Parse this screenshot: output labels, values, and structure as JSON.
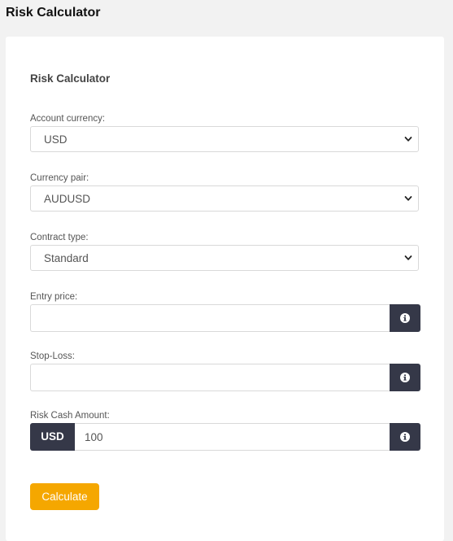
{
  "page": {
    "title": "Risk Calculator"
  },
  "card": {
    "title": "Risk Calculator"
  },
  "fields": {
    "account_currency": {
      "label": "Account currency:",
      "value": "USD"
    },
    "currency_pair": {
      "label": "Currency pair:",
      "value": "AUDUSD"
    },
    "contract_type": {
      "label": "Contract type:",
      "value": "Standard"
    },
    "entry_price": {
      "label": "Entry price:",
      "value": ""
    },
    "stop_loss": {
      "label": "Stop-Loss:",
      "value": ""
    },
    "risk_cash_amount": {
      "label": "Risk Cash Amount:",
      "currency": "USD",
      "value": "100"
    }
  },
  "actions": {
    "calculate_label": "Calculate"
  },
  "icons": {
    "chevron": "chevron-down-icon",
    "info": "info-icon"
  },
  "colors": {
    "accent": "#f5a700",
    "dark": "#353848",
    "background": "#f2f2f2",
    "card": "#ffffff",
    "border": "#d9d9d9"
  }
}
